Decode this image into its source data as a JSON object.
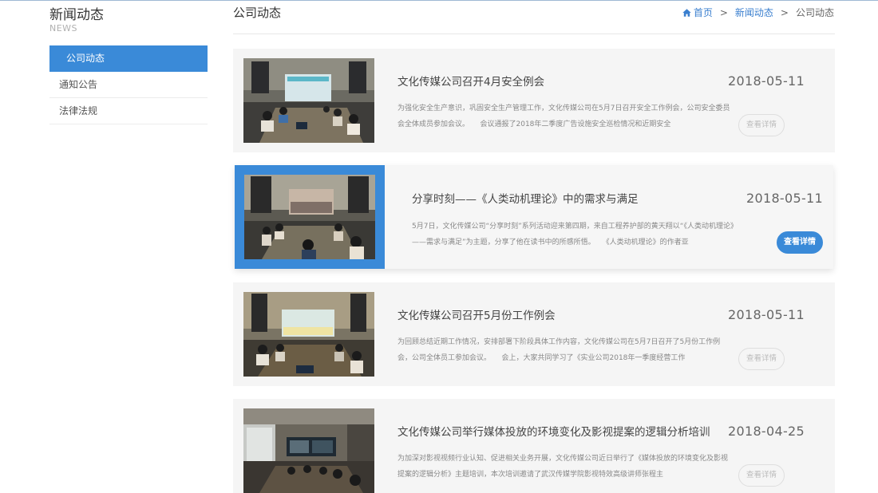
{
  "sidebar": {
    "title": "新闻动态",
    "subtitle": "NEWS",
    "items": [
      {
        "label": "公司动态"
      },
      {
        "label": "通知公告"
      },
      {
        "label": "法律法规"
      }
    ]
  },
  "main": {
    "title": "公司动态",
    "breadcrumb": {
      "home": "首页",
      "sep1": ">",
      "news": "新闻动态",
      "sep2": ">",
      "current": "公司动态"
    }
  },
  "articles": [
    {
      "title": "文化传媒公司召开4月安全例会",
      "date": "2018-05-11",
      "desc": "为强化安全生产意识，巩固安全生产管理工作，文化传媒公司在5月7日召开安全工作例会，公司安全委员会全体成员参加会议。　　会议通报了2018年二季度广告设施安全巡检情况和近期安全",
      "button": "查看详情"
    },
    {
      "title": "分享时刻——《人类动机理论》中的需求与满足",
      "date": "2018-05-11",
      "desc": "5月7日，文化传媒公司“分享时刻”系列活动迎来第四期，来自工程养护部的黄天翔以“《人类动机理论》——需求与满足”为主题，分享了他在读书中的所感所悟。　　《人类动机理论》的作者亚",
      "button": "查看详情"
    },
    {
      "title": "文化传媒公司召开5月份工作例会",
      "date": "2018-05-11",
      "desc": "为回顾总结近期工作情况，安排部署下阶段具体工作内容，文化传媒公司在5月7日召开了5月份工作例会，公司全体员工参加会议。　　会上，大家共同学习了《实业公司2018年一季度经营工作",
      "button": "查看详情"
    },
    {
      "title": "文化传媒公司举行媒体投放的环境变化及影视提案的逻辑分析培训",
      "date": "2018-04-25",
      "desc": "为加深对影视视频行业认知、促进相关业务开展，文化传媒公司近日举行了《媒体投放的环境变化及影视提案的逻辑分析》主题培训，本次培训邀请了武汉传媒学院影视特效高级讲师张程主",
      "button": "查看详情"
    }
  ],
  "colors": {
    "accent": "#3a8ad8",
    "card_bg": "#f5f5f5"
  },
  "icons": {
    "home": "home-icon"
  }
}
